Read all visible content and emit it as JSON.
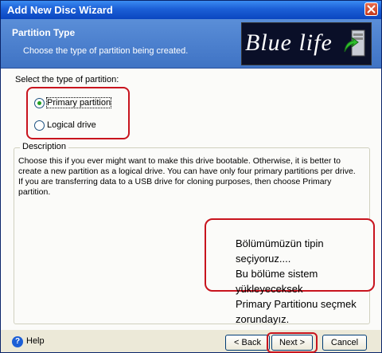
{
  "window": {
    "title": "Add New Disc Wizard"
  },
  "header": {
    "title": "Partition Type",
    "subtitle": "Choose the type of partition being created.",
    "logo_text": "Blue life"
  },
  "partition": {
    "label": "Select the type of partition:",
    "options": [
      {
        "label": "Primary partition",
        "checked": true
      },
      {
        "label": "Logical drive",
        "checked": false
      }
    ]
  },
  "description": {
    "title": "Description",
    "text": "Choose this if you ever might want to make this drive bootable. Otherwise, it is better to create a new partition as a logical drive. You can have only four primary partitions per drive. If you are transferring data to a USB drive for cloning purposes, then choose Primary partition."
  },
  "annotation": {
    "lines": [
      "Bölümümüzün tipin seçiyoruz....",
      "Bu bölüme sistem yükleyeceksek",
      "Primary Partitionu seçmek zorundayız."
    ]
  },
  "footer": {
    "help": "Help",
    "back": "< Back",
    "next": "Next >",
    "cancel": "Cancel"
  },
  "colors": {
    "annotation_red": "#c8141e",
    "header_blue": "#4a7fcd"
  }
}
